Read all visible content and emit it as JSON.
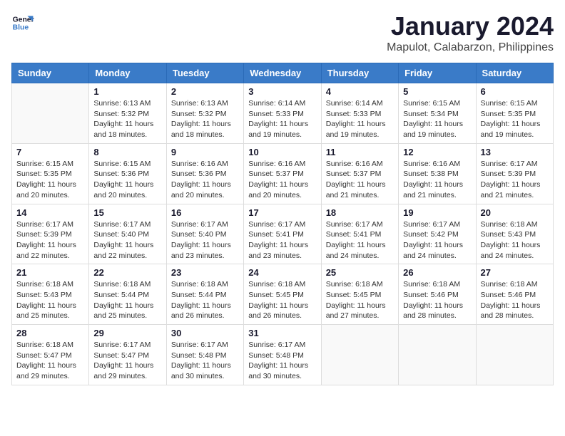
{
  "logo": {
    "line1": "General",
    "line2": "Blue"
  },
  "title": "January 2024",
  "subtitle": "Mapulot, Calabarzon, Philippines",
  "headers": [
    "Sunday",
    "Monday",
    "Tuesday",
    "Wednesday",
    "Thursday",
    "Friday",
    "Saturday"
  ],
  "weeks": [
    [
      {
        "day": "",
        "info": ""
      },
      {
        "day": "1",
        "info": "Sunrise: 6:13 AM\nSunset: 5:32 PM\nDaylight: 11 hours\nand 18 minutes."
      },
      {
        "day": "2",
        "info": "Sunrise: 6:13 AM\nSunset: 5:32 PM\nDaylight: 11 hours\nand 18 minutes."
      },
      {
        "day": "3",
        "info": "Sunrise: 6:14 AM\nSunset: 5:33 PM\nDaylight: 11 hours\nand 19 minutes."
      },
      {
        "day": "4",
        "info": "Sunrise: 6:14 AM\nSunset: 5:33 PM\nDaylight: 11 hours\nand 19 minutes."
      },
      {
        "day": "5",
        "info": "Sunrise: 6:15 AM\nSunset: 5:34 PM\nDaylight: 11 hours\nand 19 minutes."
      },
      {
        "day": "6",
        "info": "Sunrise: 6:15 AM\nSunset: 5:35 PM\nDaylight: 11 hours\nand 19 minutes."
      }
    ],
    [
      {
        "day": "7",
        "info": "Sunrise: 6:15 AM\nSunset: 5:35 PM\nDaylight: 11 hours\nand 20 minutes."
      },
      {
        "day": "8",
        "info": "Sunrise: 6:15 AM\nSunset: 5:36 PM\nDaylight: 11 hours\nand 20 minutes."
      },
      {
        "day": "9",
        "info": "Sunrise: 6:16 AM\nSunset: 5:36 PM\nDaylight: 11 hours\nand 20 minutes."
      },
      {
        "day": "10",
        "info": "Sunrise: 6:16 AM\nSunset: 5:37 PM\nDaylight: 11 hours\nand 20 minutes."
      },
      {
        "day": "11",
        "info": "Sunrise: 6:16 AM\nSunset: 5:37 PM\nDaylight: 11 hours\nand 21 minutes."
      },
      {
        "day": "12",
        "info": "Sunrise: 6:16 AM\nSunset: 5:38 PM\nDaylight: 11 hours\nand 21 minutes."
      },
      {
        "day": "13",
        "info": "Sunrise: 6:17 AM\nSunset: 5:39 PM\nDaylight: 11 hours\nand 21 minutes."
      }
    ],
    [
      {
        "day": "14",
        "info": "Sunrise: 6:17 AM\nSunset: 5:39 PM\nDaylight: 11 hours\nand 22 minutes."
      },
      {
        "day": "15",
        "info": "Sunrise: 6:17 AM\nSunset: 5:40 PM\nDaylight: 11 hours\nand 22 minutes."
      },
      {
        "day": "16",
        "info": "Sunrise: 6:17 AM\nSunset: 5:40 PM\nDaylight: 11 hours\nand 23 minutes."
      },
      {
        "day": "17",
        "info": "Sunrise: 6:17 AM\nSunset: 5:41 PM\nDaylight: 11 hours\nand 23 minutes."
      },
      {
        "day": "18",
        "info": "Sunrise: 6:17 AM\nSunset: 5:41 PM\nDaylight: 11 hours\nand 24 minutes."
      },
      {
        "day": "19",
        "info": "Sunrise: 6:17 AM\nSunset: 5:42 PM\nDaylight: 11 hours\nand 24 minutes."
      },
      {
        "day": "20",
        "info": "Sunrise: 6:18 AM\nSunset: 5:43 PM\nDaylight: 11 hours\nand 24 minutes."
      }
    ],
    [
      {
        "day": "21",
        "info": "Sunrise: 6:18 AM\nSunset: 5:43 PM\nDaylight: 11 hours\nand 25 minutes."
      },
      {
        "day": "22",
        "info": "Sunrise: 6:18 AM\nSunset: 5:44 PM\nDaylight: 11 hours\nand 25 minutes."
      },
      {
        "day": "23",
        "info": "Sunrise: 6:18 AM\nSunset: 5:44 PM\nDaylight: 11 hours\nand 26 minutes."
      },
      {
        "day": "24",
        "info": "Sunrise: 6:18 AM\nSunset: 5:45 PM\nDaylight: 11 hours\nand 26 minutes."
      },
      {
        "day": "25",
        "info": "Sunrise: 6:18 AM\nSunset: 5:45 PM\nDaylight: 11 hours\nand 27 minutes."
      },
      {
        "day": "26",
        "info": "Sunrise: 6:18 AM\nSunset: 5:46 PM\nDaylight: 11 hours\nand 28 minutes."
      },
      {
        "day": "27",
        "info": "Sunrise: 6:18 AM\nSunset: 5:46 PM\nDaylight: 11 hours\nand 28 minutes."
      }
    ],
    [
      {
        "day": "28",
        "info": "Sunrise: 6:18 AM\nSunset: 5:47 PM\nDaylight: 11 hours\nand 29 minutes."
      },
      {
        "day": "29",
        "info": "Sunrise: 6:17 AM\nSunset: 5:47 PM\nDaylight: 11 hours\nand 29 minutes."
      },
      {
        "day": "30",
        "info": "Sunrise: 6:17 AM\nSunset: 5:48 PM\nDaylight: 11 hours\nand 30 minutes."
      },
      {
        "day": "31",
        "info": "Sunrise: 6:17 AM\nSunset: 5:48 PM\nDaylight: 11 hours\nand 30 minutes."
      },
      {
        "day": "",
        "info": ""
      },
      {
        "day": "",
        "info": ""
      },
      {
        "day": "",
        "info": ""
      }
    ]
  ]
}
